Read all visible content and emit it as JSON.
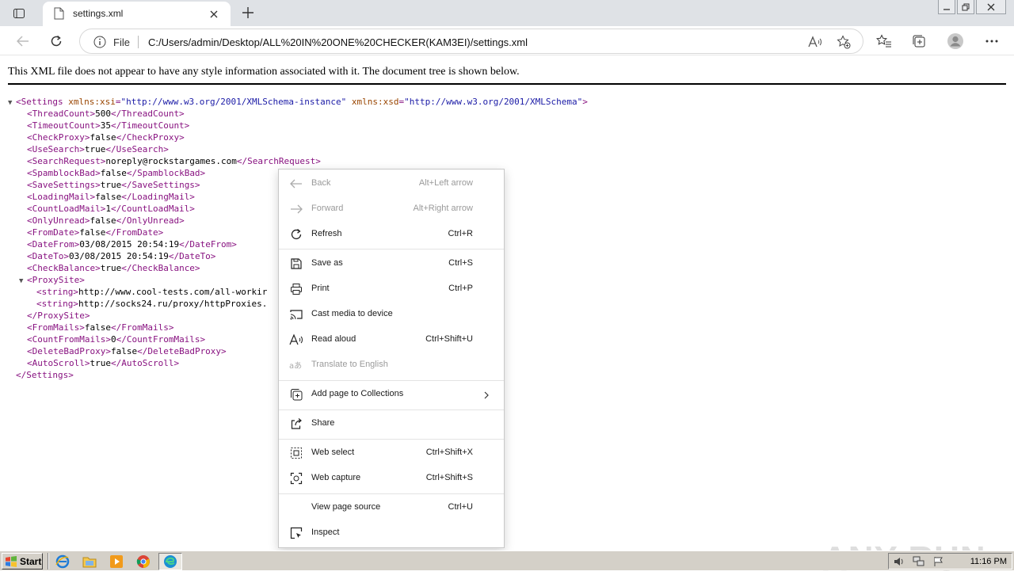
{
  "tab": {
    "title": "settings.xml"
  },
  "address": {
    "scheme_label": "File",
    "url": "C:/Users/admin/Desktop/ALL%20IN%20ONE%20CHECKER(KAM3EI)/settings.xml"
  },
  "xml_notice": "This XML file does not appear to have any style information associated with it. The document tree is shown below.",
  "xml": {
    "root_open": {
      "tag": "Settings",
      "attr1_name": "xmlns:xsi",
      "attr1_value": "\"http://www.w3.org/2001/XMLSchema-instance\"",
      "attr2_name": "xmlns:xsd",
      "attr2_value": "\"http://www.w3.org/2001/XMLSchema\""
    },
    "elements": [
      {
        "open": "<ThreadCount>",
        "value": "500",
        "close": "</ThreadCount>"
      },
      {
        "open": "<TimeoutCount>",
        "value": "35",
        "close": "</TimeoutCount>"
      },
      {
        "open": "<CheckProxy>",
        "value": "false",
        "close": "</CheckProxy>"
      },
      {
        "open": "<UseSearch>",
        "value": "true",
        "close": "</UseSearch>"
      },
      {
        "open": "<SearchRequest>",
        "value": "noreply@rockstargames.com",
        "close": "</SearchRequest>"
      },
      {
        "open": "<SpamblockBad>",
        "value": "false",
        "close": "</SpamblockBad>"
      },
      {
        "open": "<SaveSettings>",
        "value": "true",
        "close": "</SaveSettings>"
      },
      {
        "open": "<LoadingMail>",
        "value": "false",
        "close": "</LoadingMail>"
      },
      {
        "open": "<CountLoadMail>",
        "value": "1",
        "close": "</CountLoadMail>"
      },
      {
        "open": "<OnlyUnread>",
        "value": "false",
        "close": "</OnlyUnread>"
      },
      {
        "open": "<FromDate>",
        "value": "false",
        "close": "</FromDate>"
      },
      {
        "open": "<DateFrom>",
        "value": "03/08/2015 20:54:19",
        "close": "</DateFrom>"
      },
      {
        "open": "<DateTo>",
        "value": "03/08/2015 20:54:19",
        "close": "</DateTo>"
      },
      {
        "open": "<CheckBalance>",
        "value": "true",
        "close": "</CheckBalance>"
      }
    ],
    "proxy_open": "<ProxySite>",
    "proxy_strings": [
      {
        "open": "<string>",
        "value": "http://www.cool-tests.com/all-workir"
      },
      {
        "open": "<string>",
        "value": "http://socks24.ru/proxy/httpProxies."
      }
    ],
    "proxy_close": "</ProxySite>",
    "elements2": [
      {
        "open": "<FromMails>",
        "value": "false",
        "close": "</FromMails>"
      },
      {
        "open": "<CountFromMails>",
        "value": "0",
        "close": "</CountFromMails>"
      },
      {
        "open": "<DeleteBadProxy>",
        "value": "false",
        "close": "</DeleteBadProxy>"
      },
      {
        "open": "<AutoScroll>",
        "value": "true",
        "close": "</AutoScroll>"
      }
    ],
    "root_close": "</Settings>"
  },
  "context_menu": {
    "items": [
      {
        "label": "Back",
        "shortcut": "Alt+Left arrow",
        "icon": "arrow-left-icon",
        "disabled": true
      },
      {
        "label": "Forward",
        "shortcut": "Alt+Right arrow",
        "icon": "arrow-right-icon",
        "disabled": true
      },
      {
        "label": "Refresh",
        "shortcut": "Ctrl+R",
        "icon": "refresh-icon"
      },
      {
        "label": "Save as",
        "shortcut": "Ctrl+S",
        "icon": "save-icon"
      },
      {
        "label": "Print",
        "shortcut": "Ctrl+P",
        "icon": "print-icon"
      },
      {
        "label": "Cast media to device",
        "shortcut": "",
        "icon": "cast-icon"
      },
      {
        "label": "Read aloud",
        "shortcut": "Ctrl+Shift+U",
        "icon": "read-aloud-icon"
      },
      {
        "label": "Translate to English",
        "shortcut": "",
        "icon": "translate-icon",
        "disabled": true
      },
      {
        "label": "Add page to Collections",
        "shortcut": "",
        "icon": "collections-icon"
      },
      {
        "label": "Share",
        "shortcut": "",
        "icon": "share-icon"
      },
      {
        "label": "Web select",
        "shortcut": "Ctrl+Shift+X",
        "icon": "web-select-icon"
      },
      {
        "label": "Web capture",
        "shortcut": "Ctrl+Shift+S",
        "icon": "web-capture-icon"
      },
      {
        "label": "View page source",
        "shortcut": "Ctrl+U",
        "icon": ""
      },
      {
        "label": "Inspect",
        "shortcut": "",
        "icon": "inspect-icon"
      }
    ]
  },
  "watermark": "ANY RUN",
  "taskbar": {
    "start_label": "Start",
    "clock": "11:16 PM"
  }
}
